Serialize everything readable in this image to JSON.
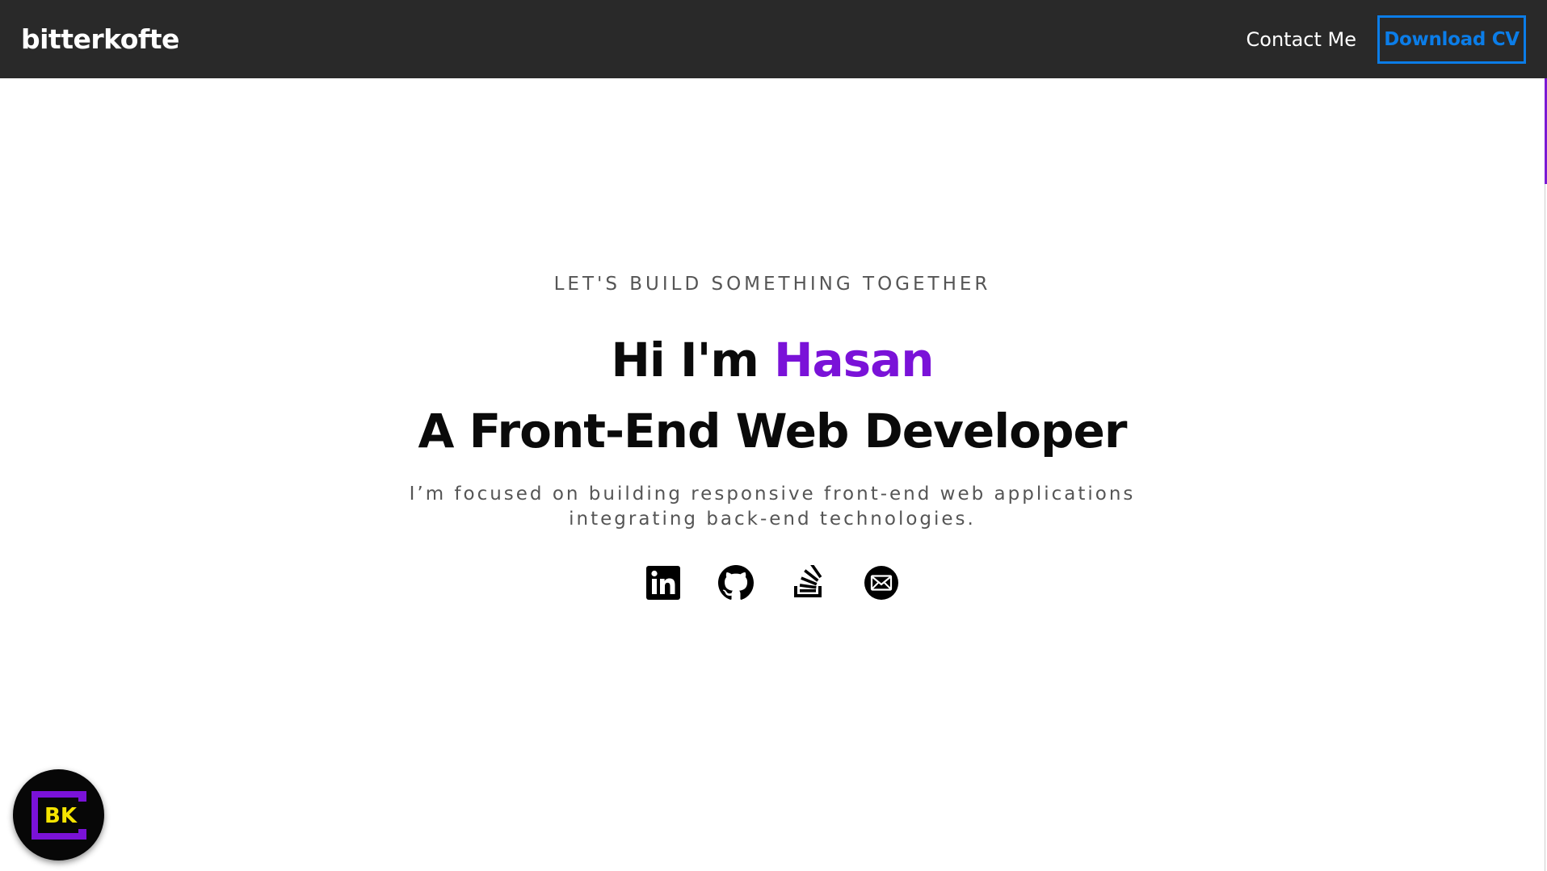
{
  "nav": {
    "brand": "bitterkofte",
    "contact_label": "Contact Me",
    "cv_label": "Download CV"
  },
  "hero": {
    "tagline": "LET'S BUILD SOMETHING TOGETHER",
    "greeting_prefix": "Hi I'm ",
    "name": "Hasan",
    "role": "A Front-End Web Developer",
    "description_line1": "I’m focused on building responsive front-end web applications",
    "description_line2": "integrating back-end technologies."
  },
  "socials": [
    {
      "icon": "linkedin-icon"
    },
    {
      "icon": "github-icon"
    },
    {
      "icon": "stackoverflow-icon"
    },
    {
      "icon": "mail-icon"
    }
  ],
  "floating_logo": {
    "text": "BK",
    "ring_color": "#7a12d8",
    "text_color": "#f5e400"
  },
  "colors": {
    "navbar_bg": "#292929",
    "accent_blue": "#0b7de8",
    "accent_purple": "#7a12d8"
  }
}
